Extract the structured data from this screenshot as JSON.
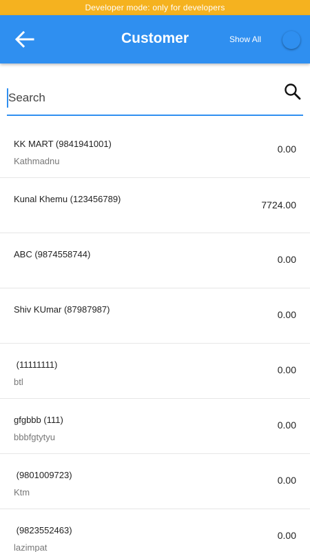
{
  "banner": {
    "text": "Developer mode: only for developers"
  },
  "app_bar": {
    "title": "Customer",
    "show_all_label": "Show All",
    "show_all_on": false
  },
  "search": {
    "placeholder": "Search",
    "value": ""
  },
  "customers": [
    {
      "name": "KK MART (9841941001)",
      "address": "Kathmadnu",
      "amount": "0.00"
    },
    {
      "name": "Kunal Khemu (123456789)",
      "address": "",
      "amount": "7724.00"
    },
    {
      "name": "ABC (9874558744)",
      "address": "",
      "amount": "0.00"
    },
    {
      "name": "Shiv KUmar (87987987)",
      "address": "",
      "amount": "0.00"
    },
    {
      "name": " (11111111)",
      "address": "btl",
      "amount": "0.00"
    },
    {
      "name": "gfgbbb (111)",
      "address": "bbbfgtytyu",
      "amount": "0.00"
    },
    {
      "name": " (9801009723)",
      "address": "Ktm",
      "amount": "0.00"
    },
    {
      "name": " (9823552463)",
      "address": "lazimpat",
      "amount": "0.00"
    }
  ],
  "colors": {
    "primary": "#2f8ff0",
    "banner": "#f5b21f"
  }
}
